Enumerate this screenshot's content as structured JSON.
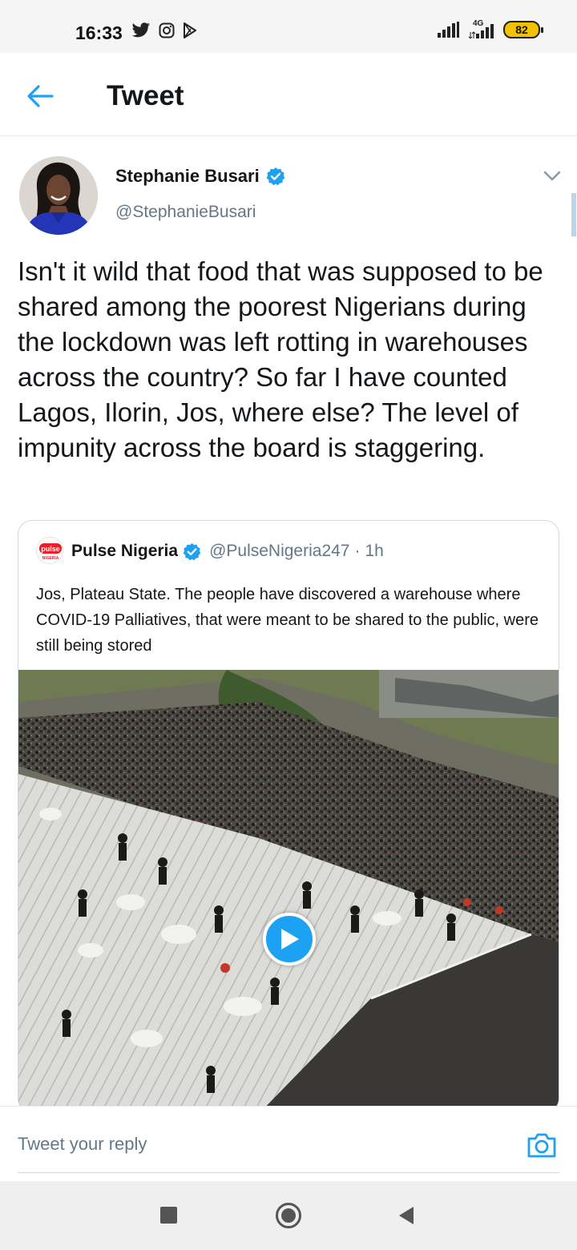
{
  "status_bar": {
    "time": "16:33",
    "network": "4G",
    "battery": "82",
    "icons": [
      "twitter-icon",
      "instagram-icon",
      "play-store-icon",
      "signal-icon",
      "signal-4g-icon",
      "battery-icon"
    ]
  },
  "header": {
    "title": "Tweet",
    "back_icon": "arrow-left-icon"
  },
  "tweet": {
    "author_name": "Stephanie Busari",
    "author_handle": "@StephanieBusari",
    "verified": true,
    "text": "Isn't it wild that food that was supposed to be shared among the poorest Nigerians during the lockdown was left rotting in warehouses across the country? So far I have counted Lagos, Ilorin, Jos, where else? The level of impunity across the board is staggering."
  },
  "quoted_tweet": {
    "logo_text": "pulse",
    "logo_sub": "NIGERIA",
    "name": "Pulse Nigeria",
    "handle": "@PulseNigeria247",
    "separator": "·",
    "time": "1h",
    "text": "Jos, Plateau State. The people have discovered a warehouse where COVID-19 Palliatives, that were meant to be shared to the public, were still being stored",
    "media_type": "video"
  },
  "reply": {
    "placeholder": "Tweet your reply",
    "camera_icon": "camera-icon"
  },
  "colors": {
    "accent": "#1da1f2",
    "text": "#14171a",
    "secondary": "#657786",
    "divider": "#e6ecf0"
  }
}
